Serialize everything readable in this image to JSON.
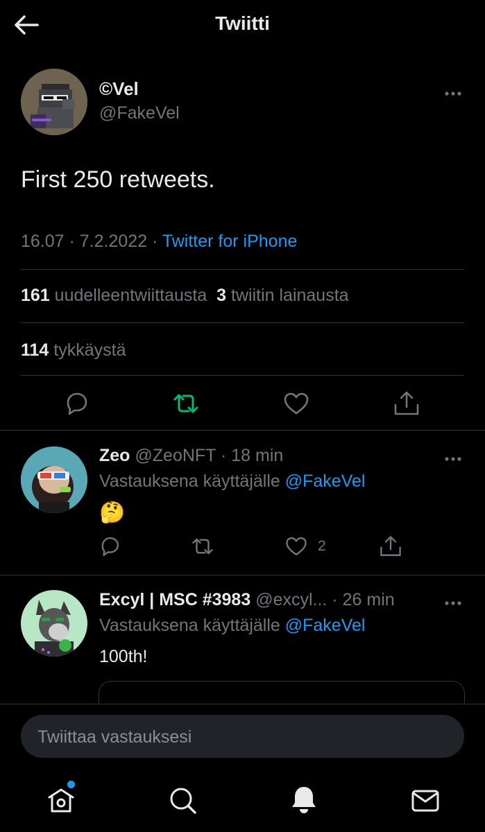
{
  "header": {
    "title": "Twiitti"
  },
  "main_tweet": {
    "display_name": "©Vel",
    "handle": "@FakeVel",
    "text": "First 250 retweets.",
    "time_date": "16.07 · 7.2.2022 · ",
    "source": "Twitter for iPhone",
    "retweets": {
      "count": "161",
      "label": "uudelleentwiittausta"
    },
    "quotes": {
      "count": "3",
      "label": "twiitin lainausta"
    },
    "likes": {
      "count": "114",
      "label": "tykkäystä"
    },
    "actions": [
      "reply-icon",
      "retweet-icon",
      "like-icon",
      "share-icon"
    ],
    "retweet_color": "#00ba7c"
  },
  "replies": [
    {
      "display_name": "Zeo",
      "handle": "@ZeoNFT",
      "time": "· 18 min",
      "replying_to_prefix": "Vastauksena käyttäjälle ",
      "replying_to": "@FakeVel",
      "text": "🤔",
      "like_count": "2"
    },
    {
      "display_name": "Excyl | MSC #3983",
      "handle": "@excyl...",
      "time": "· 26 min",
      "replying_to_prefix": "Vastauksena käyttäjälle ",
      "replying_to": "@FakeVel",
      "text": "100th!"
    }
  ],
  "composer": {
    "placeholder": "Twiittaa vastauksesi"
  },
  "bottom_nav": {
    "items": [
      "home-icon",
      "search-icon",
      "notifications-icon",
      "messages-icon"
    ],
    "home_badge_color": "#1d9bf0"
  },
  "colors": {
    "accent": "#1d9bf0",
    "background": "#000000",
    "muted": "#71767b"
  }
}
